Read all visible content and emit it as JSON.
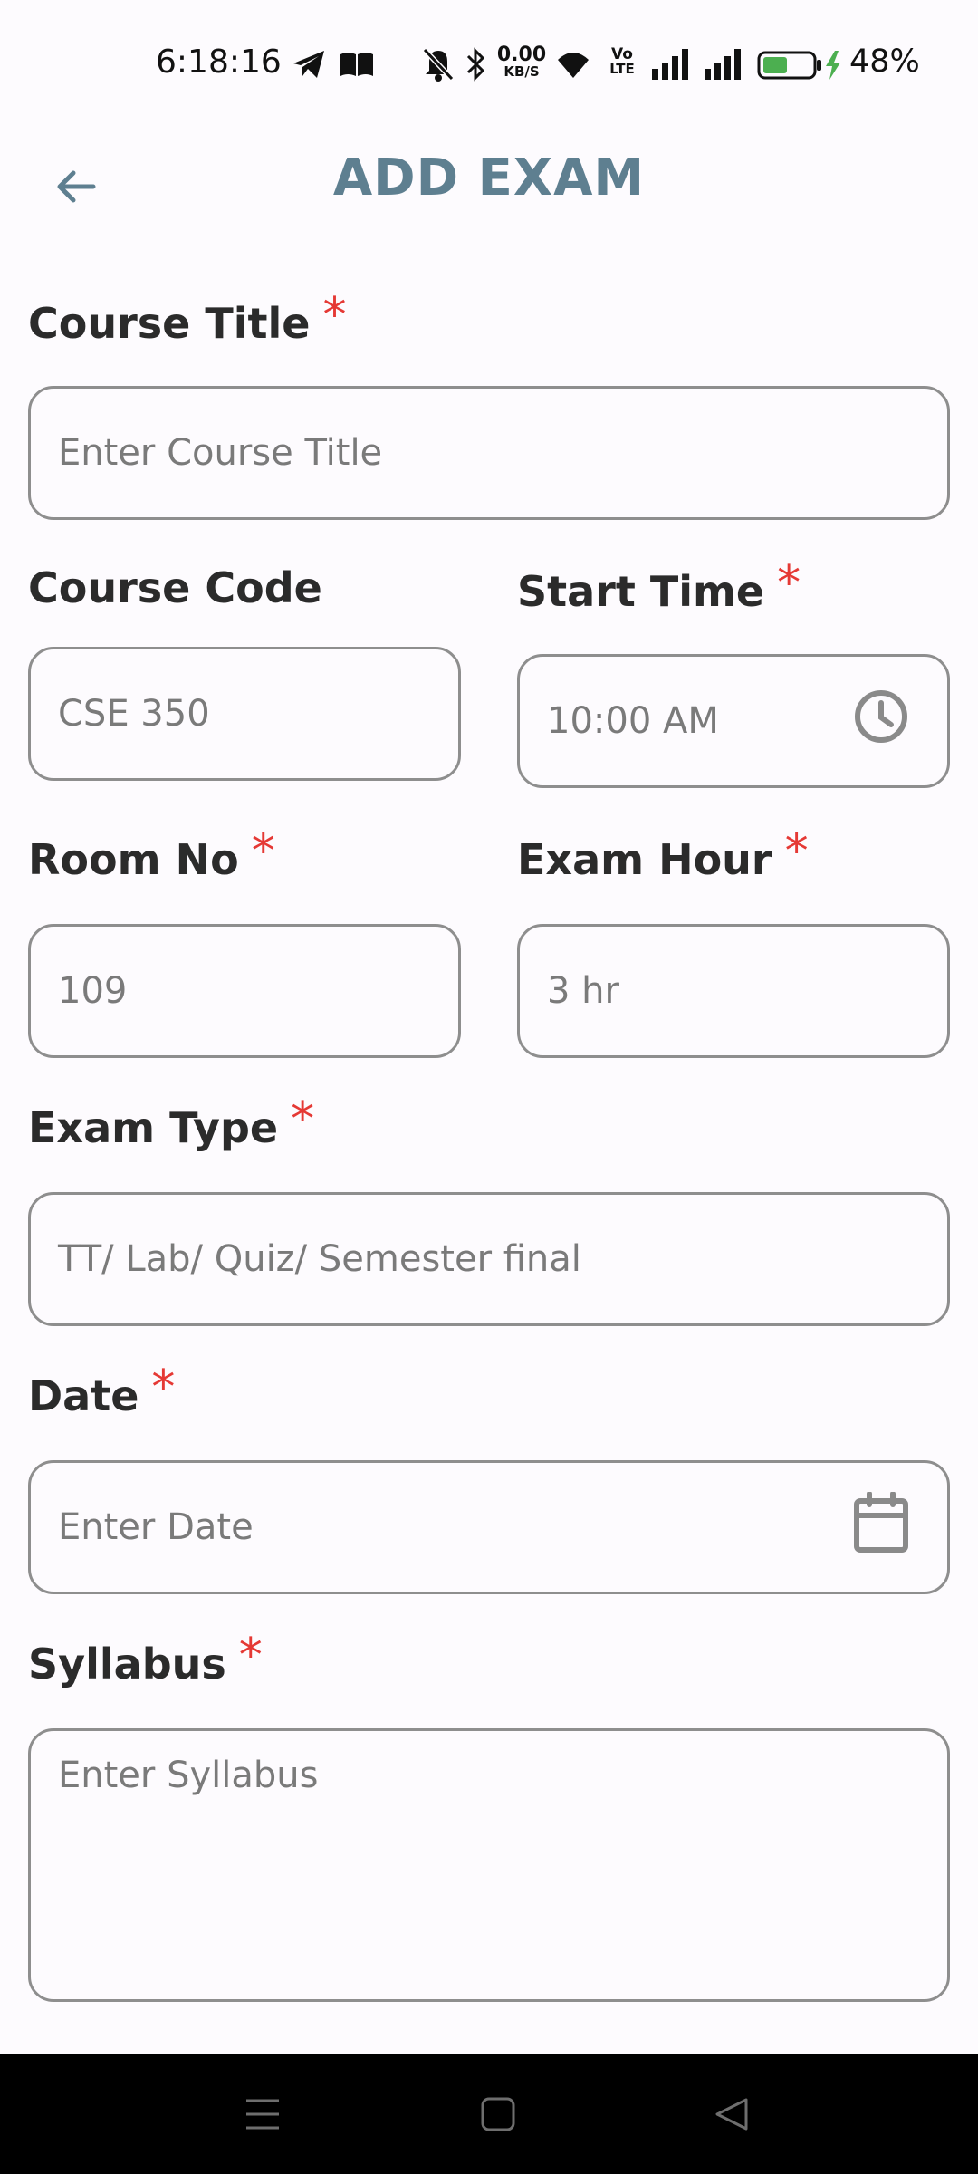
{
  "status_bar": {
    "time": "6:18:16",
    "net_speed_value": "0.00",
    "net_speed_unit": "KB/S",
    "volte_top": "Vo",
    "volte_bottom": "LTE",
    "battery_percent": "48%"
  },
  "header": {
    "title": "ADD EXAM"
  },
  "form": {
    "course_title": {
      "label": "Course Title",
      "required_mark": "*",
      "placeholder": "Enter Course Title"
    },
    "course_code": {
      "label": "Course Code",
      "placeholder": "CSE 350"
    },
    "start_time": {
      "label": "Start Time",
      "required_mark": "*",
      "placeholder": "10:00 AM"
    },
    "room_no": {
      "label": "Room No",
      "required_mark": "*",
      "placeholder": "109"
    },
    "exam_hour": {
      "label": "Exam Hour",
      "required_mark": "*",
      "placeholder": "3 hr"
    },
    "exam_type": {
      "label": "Exam Type",
      "required_mark": "*",
      "placeholder": "TT/ Lab/ Quiz/ Semester final"
    },
    "date": {
      "label": "Date",
      "required_mark": "*",
      "placeholder": "Enter Date"
    },
    "syllabus": {
      "label": "Syllabus",
      "required_mark": "*",
      "placeholder": "Enter Syllabus"
    }
  },
  "colors": {
    "title": "#5E7F90",
    "required": "#E53935",
    "field_border": "#8E8E8E",
    "placeholder": "#7A7A7A",
    "battery_fill": "#4CAF50"
  },
  "icons": {
    "back": "arrow-left-icon",
    "start_time": "clock-icon",
    "date": "calendar-icon"
  }
}
